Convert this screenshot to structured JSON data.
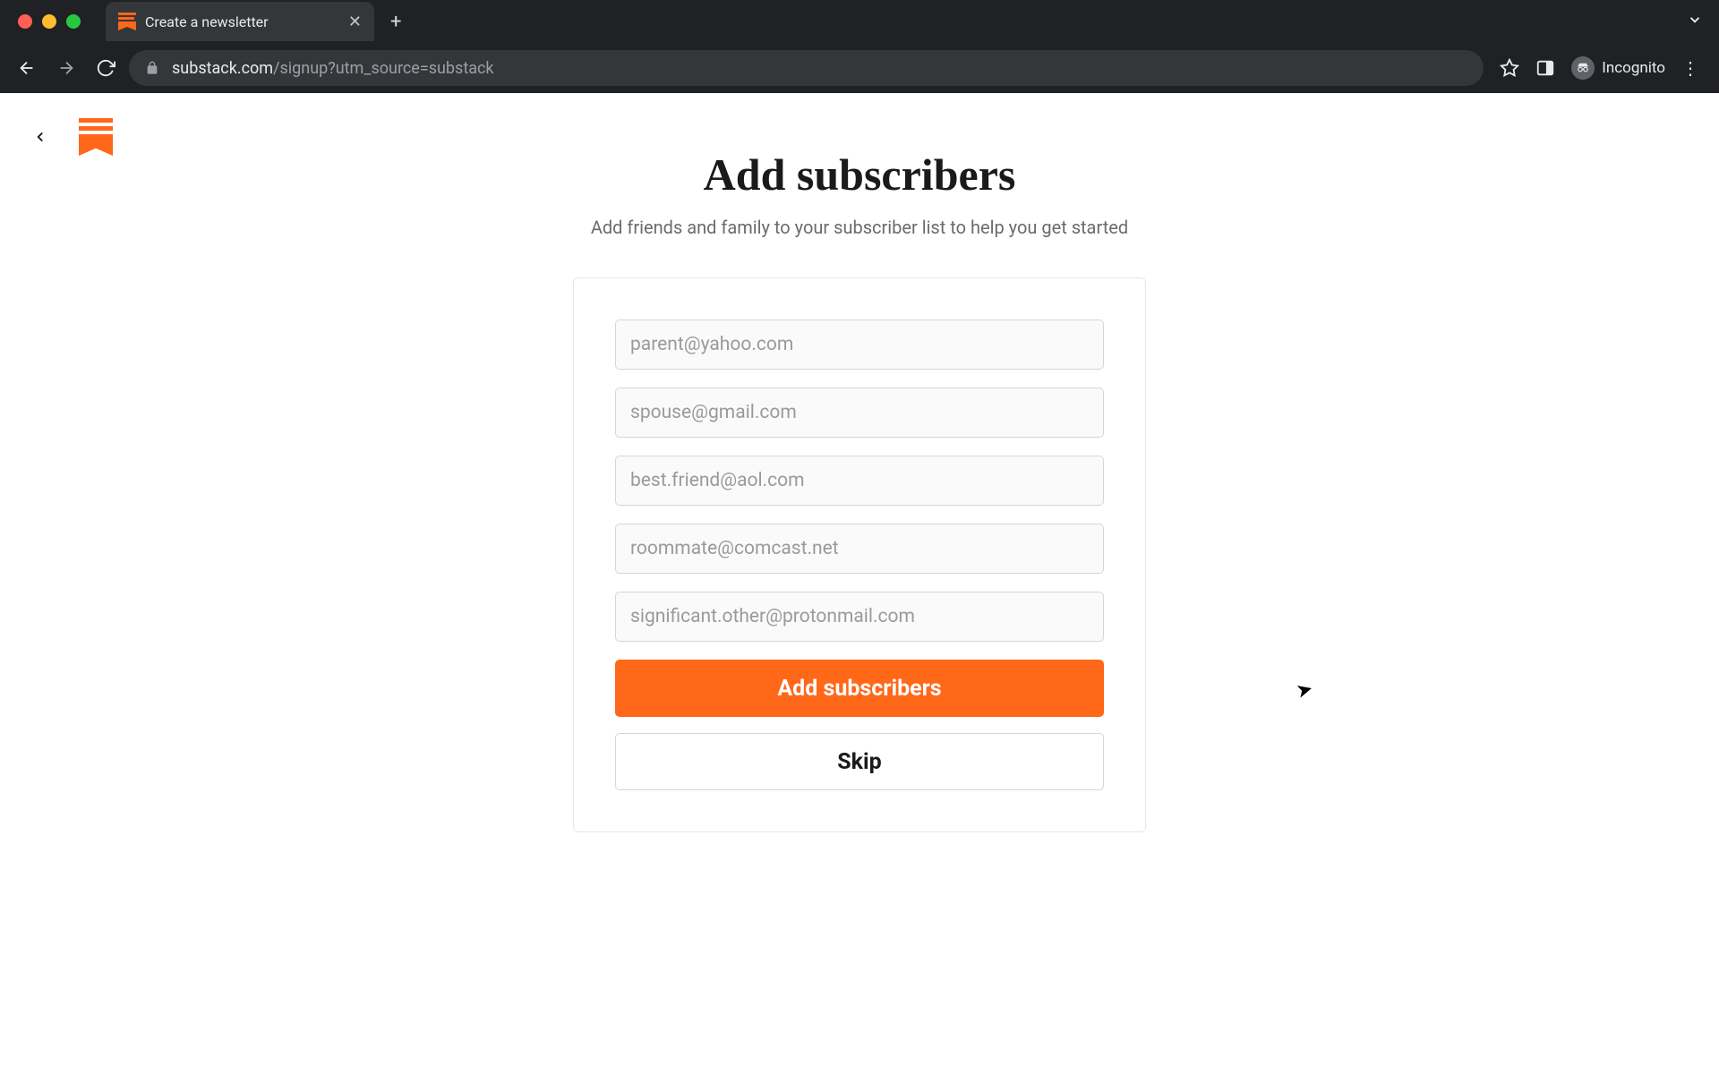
{
  "browser": {
    "tab_title": "Create a newsletter",
    "url_host": "substack.com",
    "url_path": "/signup?utm_source=substack",
    "incognito_label": "Incognito"
  },
  "page": {
    "title": "Add subscribers",
    "subtitle": "Add friends and family to your subscriber list to help you get started",
    "inputs": [
      {
        "placeholder": "parent@yahoo.com"
      },
      {
        "placeholder": "spouse@gmail.com"
      },
      {
        "placeholder": "best.friend@aol.com"
      },
      {
        "placeholder": "roommate@comcast.net"
      },
      {
        "placeholder": "significant.other@protonmail.com"
      }
    ],
    "primary_button": "Add subscribers",
    "secondary_button": "Skip"
  }
}
